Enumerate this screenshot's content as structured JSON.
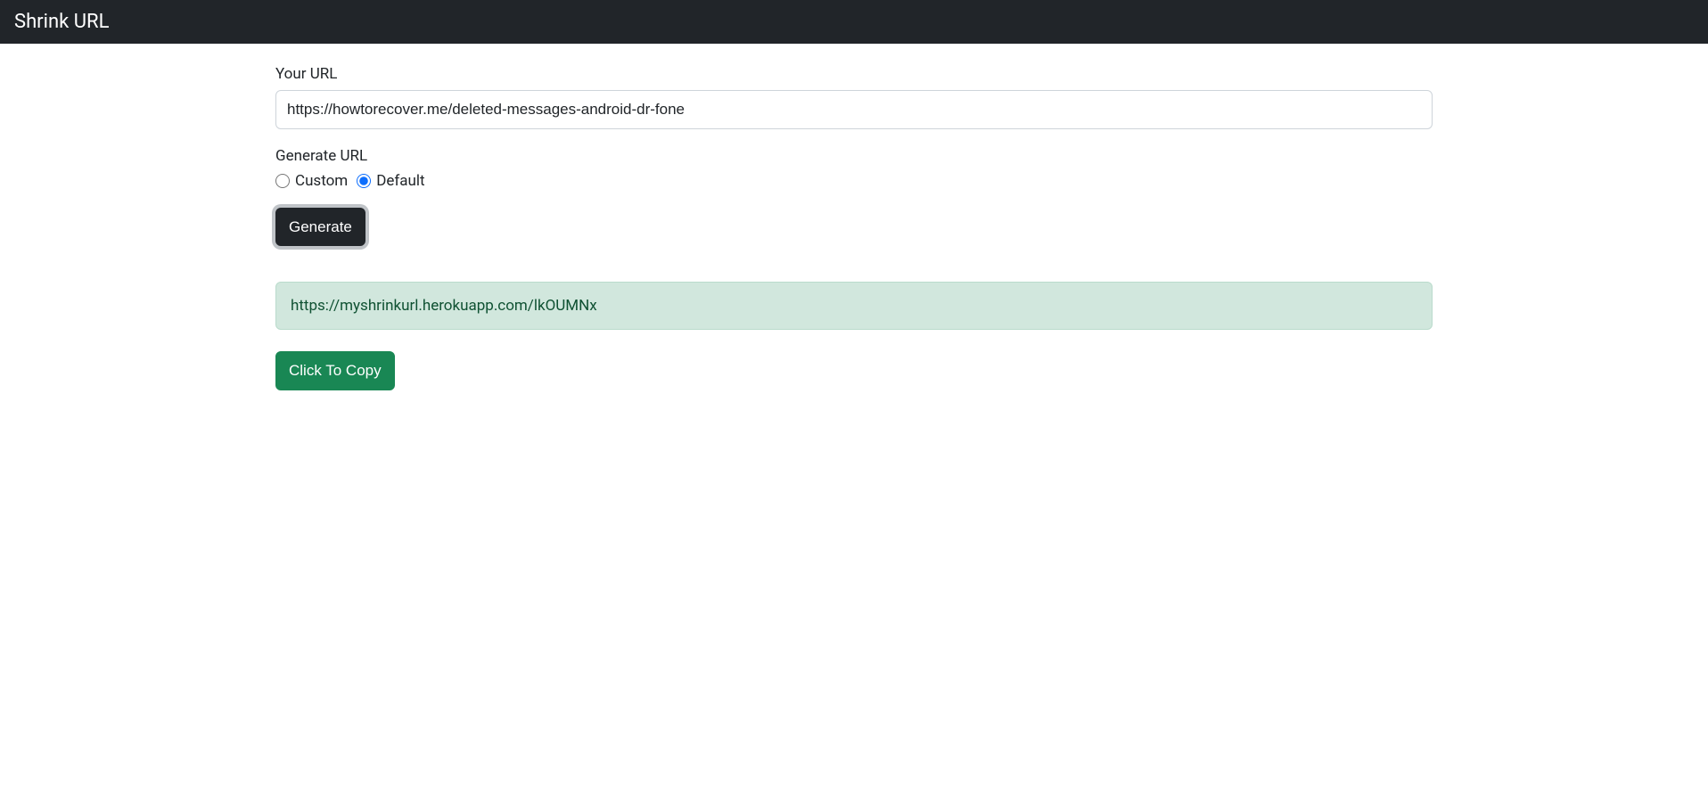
{
  "navbar": {
    "brand": "Shrink URL"
  },
  "form": {
    "url_label": "Your URL",
    "url_value": "https://howtorecover.me/deleted-messages-android-dr-fone",
    "generate_label": "Generate URL",
    "radio_custom": "Custom",
    "radio_default": "Default",
    "generate_button": "Generate"
  },
  "result": {
    "short_url": "https://myshrinkurl.herokuapp.com/lkOUMNx",
    "copy_button": "Click To Copy"
  }
}
